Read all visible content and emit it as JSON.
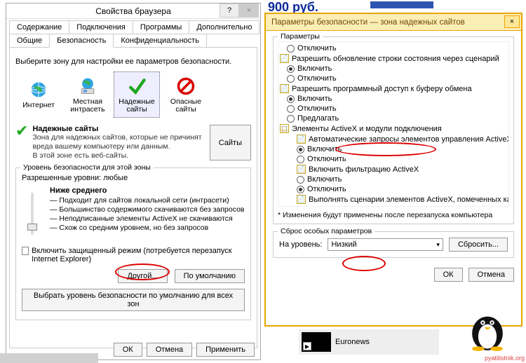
{
  "price": "900 руб.",
  "left_dialog": {
    "title": "Свойства браузера",
    "tabs_row1": [
      "Содержание",
      "Подключения",
      "Программы",
      "Дополнительно"
    ],
    "tabs_row2": [
      "Общие",
      "Безопасность",
      "Конфиденциальность"
    ],
    "active_tab": "Безопасность",
    "zone_instruction": "Выберите зону для настройки ее параметров безопасности.",
    "zones": [
      {
        "id": "internet",
        "label": "Интернет"
      },
      {
        "id": "intranet",
        "label": "Местная интрасеть"
      },
      {
        "id": "trusted",
        "label": "Надежные сайты"
      },
      {
        "id": "restricted",
        "label": "Опасные сайты"
      }
    ],
    "selected_zone": "trusted",
    "trusted_title": "Надежные сайты",
    "trusted_desc": "Зона для надежных сайтов, которые не причинят вреда вашему компьютеру или данным.",
    "trusted_extra": "В этой зоне есть веб-сайты.",
    "sites_btn": "Сайты",
    "sec_group_title": "Уровень безопасности для этой зоны",
    "allowed_levels": "Разрешенные уровни: любые",
    "level_name": "Ниже среднего",
    "level_points": [
      "— Подходит для сайтов локальной сети (интрасети)",
      "— Большинство содержимого скачиваются без запросов",
      "— Неподписанные элементы ActiveX не скачиваются",
      "— Схож со средним уровнем, но без запросов"
    ],
    "protected_mode": "Включить защищенный режим (потребуется перезапуск Internet Explorer)",
    "custom_btn": "Другой...",
    "default_btn": "По умолчанию",
    "reset_all_btn": "Выбрать уровень безопасности по умолчанию для всех зон",
    "ok": "ОК",
    "cancel": "Отмена",
    "apply": "Применить"
  },
  "right_dialog": {
    "title": "Параметры безопасности — зона надежных сайтов",
    "group_label": "Параметры",
    "tree": [
      {
        "t": "opt",
        "label": "Отключить",
        "on": false
      },
      {
        "t": "cat",
        "label": "Разрешить обновление строки состояния через сценарий"
      },
      {
        "t": "opt",
        "label": "Включить",
        "on": true
      },
      {
        "t": "opt",
        "label": "Отключить",
        "on": false
      },
      {
        "t": "cat",
        "label": "Разрешить программный доступ к буферу обмена"
      },
      {
        "t": "opt",
        "label": "Включить",
        "on": true
      },
      {
        "t": "opt",
        "label": "Отключить",
        "on": false
      },
      {
        "t": "opt",
        "label": "Предлагать",
        "on": false
      },
      {
        "t": "cat",
        "label": "Элементы ActiveX и модули подключения",
        "icon": "ax"
      },
      {
        "t": "cat",
        "label": "Автоматические запросы элементов управления ActiveX",
        "indent": true
      },
      {
        "t": "opt",
        "label": "Включить",
        "on": true,
        "indent": true
      },
      {
        "t": "opt",
        "label": "Отключить",
        "on": false,
        "indent": true
      },
      {
        "t": "cat",
        "label": "Включить фильтрацию ActiveX",
        "indent": true
      },
      {
        "t": "opt",
        "label": "Включить",
        "on": false,
        "indent": true
      },
      {
        "t": "opt",
        "label": "Отключить",
        "on": true,
        "indent": true
      },
      {
        "t": "cat",
        "label": "Выполнять сценарии элементов ActiveX, помеченных как",
        "indent": true
      }
    ],
    "restart_note": "* Изменения будут применены после перезапуска компьютера",
    "reset_group_label": "Сброс особых параметров",
    "reset_to_label": "На уровень:",
    "reset_value": "Низкий",
    "reset_btn": "Сбросить...",
    "ok": "ОК",
    "cancel": "Отмена"
  },
  "euronews": "Euronews",
  "site_watermark": "pyatilistnik.org"
}
